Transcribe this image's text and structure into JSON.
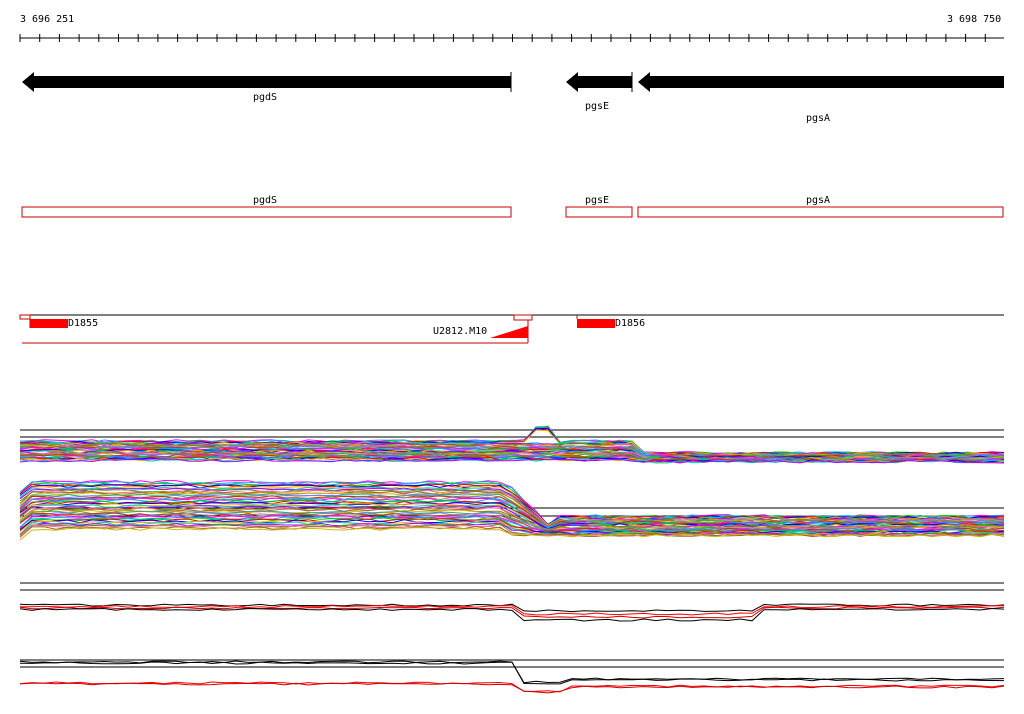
{
  "ruler": {
    "start_label": "3 696 251",
    "end_label": "3 698 750"
  },
  "genes": [
    {
      "name": "pgdS",
      "strand": "-"
    },
    {
      "name": "pgsE",
      "strand": "-"
    },
    {
      "name": "pgsA",
      "strand": "-"
    }
  ],
  "cds": [
    {
      "name": "pgdS"
    },
    {
      "name": "pgsE"
    },
    {
      "name": "pgsA"
    }
  ],
  "features": [
    {
      "name": "D1855"
    },
    {
      "name": "U2812.M10"
    },
    {
      "name": "D1856"
    }
  ],
  "colors": {
    "gene": "#000000",
    "cds_outline": "#cc0000",
    "feature_fill": "#ff0000",
    "track_lines": "#000000"
  },
  "track_palette": [
    "#ff00ff",
    "#00aaff",
    "#00cc00",
    "#ff0000",
    "#0000ff",
    "#ffaa00",
    "#00cccc",
    "#aa00ff",
    "#669900",
    "#ff6699",
    "#996633",
    "#ccbb00",
    "#33aa66",
    "#7777ff",
    "#cc3300",
    "#888888"
  ]
}
